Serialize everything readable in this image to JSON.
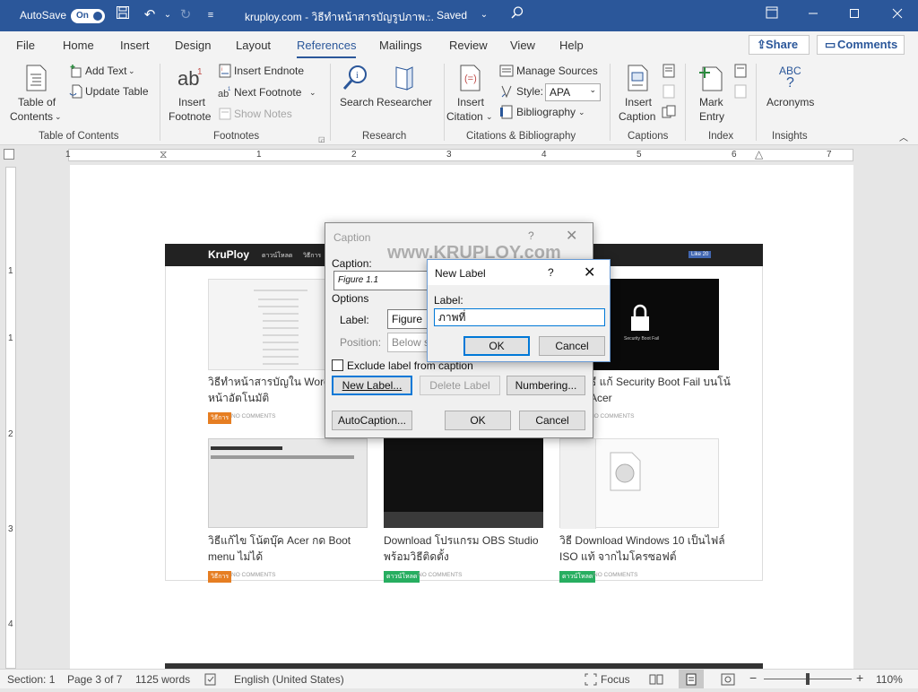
{
  "titlebar": {
    "autosave_label": "AutoSave",
    "autosave_state": "On",
    "doc_title": "kruploy.com - วิธีทำหน้าสารบัญรูปภาพ...",
    "saved_status": "Saved"
  },
  "tabs": [
    "File",
    "Home",
    "Insert",
    "Design",
    "Layout",
    "References",
    "Mailings",
    "Review",
    "View",
    "Help"
  ],
  "active_tab": "References",
  "share_label": "Share",
  "comments_label": "Comments",
  "ribbon": {
    "toc": {
      "line1": "Table of",
      "line2": "Contents",
      "add_text": "Add Text",
      "update_table": "Update Table",
      "group": "Table of Contents"
    },
    "footnotes": {
      "insert1": "Insert",
      "insert2": "Footnote",
      "insert_endnote": "Insert Endnote",
      "next_footnote": "Next Footnote",
      "show_notes": "Show Notes",
      "group": "Footnotes"
    },
    "research": {
      "search": "Search",
      "researcher": "Researcher",
      "group": "Research"
    },
    "citations": {
      "insert1": "Insert",
      "insert2": "Citation",
      "manage_sources": "Manage Sources",
      "style_label": "Style:",
      "style_value": "APA",
      "bibliography": "Bibliography",
      "group": "Citations & Bibliography"
    },
    "captions": {
      "insert1": "Insert",
      "insert2": "Caption",
      "group": "Captions"
    },
    "index": {
      "mark1": "Mark",
      "mark2": "Entry",
      "group": "Index"
    },
    "insights": {
      "abc": "ABC",
      "acronyms": "Acronyms",
      "group": "Insights"
    }
  },
  "ruler_numbers": [
    "1",
    "1",
    "2",
    "3",
    "4",
    "5",
    "6",
    "7"
  ],
  "vruler_numbers": [
    "1",
    "1",
    "2",
    "3",
    "4"
  ],
  "website": {
    "logo": "KruPloy",
    "nav1": "ดาวน์โหลด",
    "nav2": "วิธีการ",
    "fb_like": "Like 20",
    "watermark": "www.KRUPLOY.com",
    "posts": [
      {
        "title1": "วิธีทำหน้าสารบัญใน Word แ",
        "title2": "หน้าอัตโนมัติ",
        "badge": "วิธีการ",
        "comments": "NO COMMENTS"
      },
      {
        "title1": "ธี แก้ Security Boot Fail บนโน้",
        "title2": "Acer",
        "badge": "",
        "comments": "NO COMMENTS"
      },
      {
        "title1": "วิธีแก้ไข โน้ตบุ๊ค Acer กด Boot",
        "title2": "menu ไม่ได้",
        "badge": "วิธีการ",
        "comments": "NO COMMENTS"
      },
      {
        "title1": "Download โปรแกรม OBS Studio",
        "title2": "พร้อมวิธีติดตั้ง",
        "badge": "ดาวน์โหลด",
        "comments": "NO COMMENTS"
      },
      {
        "title1": "วิธี Download Windows 10 เป็นไฟล์",
        "title2": "ISO แท้ จากไมโครซอฟต์",
        "badge": "ดาวน์โหลด",
        "comments": "NO COMMENTS"
      }
    ],
    "security_text": "Security Boot Fail"
  },
  "caption_dialog": {
    "title": "Caption",
    "caption_label": "Caption:",
    "caption_value": "Figure 1.1",
    "options_label": "Options",
    "label_label": "Label:",
    "label_value": "Figure",
    "position_label": "Position:",
    "position_value": "Below s",
    "exclude_label": "Exclude label from caption",
    "new_label_btn": "New Label...",
    "delete_label_btn": "Delete Label",
    "numbering_btn": "Numbering...",
    "autocaption_btn": "AutoCaption...",
    "ok": "OK",
    "cancel": "Cancel"
  },
  "new_label_dialog": {
    "title": "New Label",
    "help": "?",
    "label_label": "Label:",
    "label_value": "ภาพที่",
    "ok": "OK",
    "cancel": "Cancel"
  },
  "statusbar": {
    "section": "Section: 1",
    "page": "Page 3 of 7",
    "words": "1125 words",
    "language": "English (United States)",
    "focus": "Focus",
    "zoom": "110%"
  },
  "colors": {
    "brand": "#2b579a",
    "dialog_focus": "#0078d7",
    "badge_orange": "#e67e22",
    "badge_green": "#27ae60"
  }
}
